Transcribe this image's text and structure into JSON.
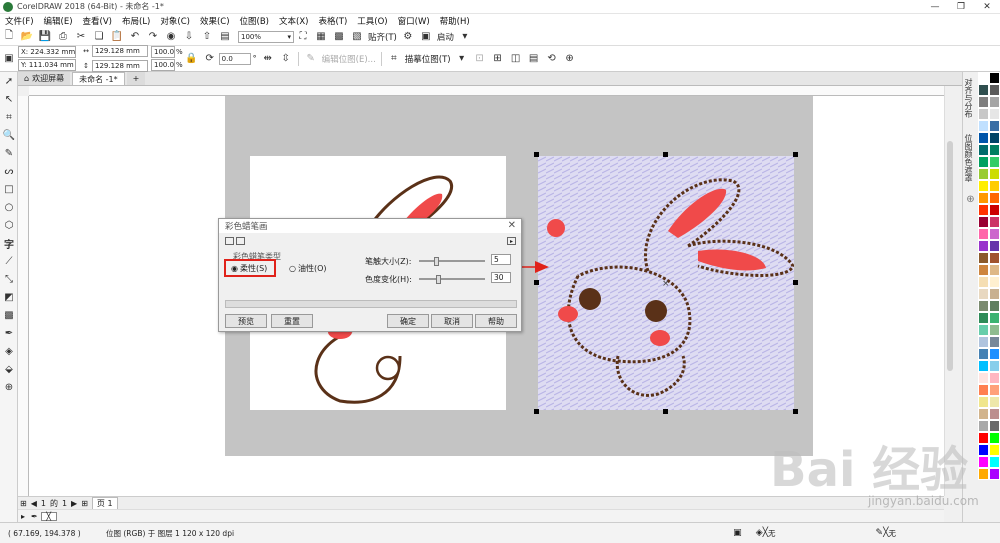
{
  "window": {
    "title": "CorelDRAW 2018 (64-Bit) - 未命名 -1*"
  },
  "menu": [
    "文件(F)",
    "编辑(E)",
    "查看(V)",
    "布局(L)",
    "对象(C)",
    "效果(C)",
    "位图(B)",
    "文本(X)",
    "表格(T)",
    "工具(O)",
    "窗口(W)",
    "帮助(H)"
  ],
  "toolbar": {
    "zoom": "100%",
    "snap": "贴齐(T)",
    "launch": "启动"
  },
  "property_bar": {
    "x": "X: 224.332 mm",
    "y": "Y: 111.034 mm",
    "w": "129.128 mm",
    "h": "129.128 mm",
    "sx": "100.0",
    "sy": "100.0",
    "pct": "%",
    "angle": "0.0",
    "deg": "°",
    "edit_bitmap": "编辑位图(E)...",
    "trace_bitmap": "描摹位图(T)"
  },
  "tabs": {
    "welcome": "欢迎屏幕",
    "doc": "未命名 -1*",
    "add": "+"
  },
  "docker_tabs": [
    "对齐与分布",
    "位图颜色遮罩"
  ],
  "dialog": {
    "title": "彩色蜡笔画",
    "group_label": "彩色蜡笔类型",
    "soft": "柔性(S)",
    "oily": "油性(O)",
    "size_label": "笔触大小(Z):",
    "size_value": "5",
    "color_var_label": "色度变化(H):",
    "color_var_value": "30",
    "preview": "预览",
    "reset": "重置",
    "ok": "确定",
    "cancel": "取消",
    "help": "帮助",
    "size_pct": 0.25,
    "var_pct": 0.28
  },
  "pagenav": {
    "current": "1",
    "of": "的",
    "total": "1",
    "page": "页 1"
  },
  "status": {
    "coords": "( 67.169, 194.378 )",
    "info": "位图 (RGB) 于 图层 1 120 x 120 dpi",
    "fill_none": "无",
    "outline_none": "无"
  },
  "watermark": {
    "brand": "Bai 经验",
    "url": "jingyan.baidu.com"
  },
  "colors": {
    "accent_red": "#e0221a",
    "crayon_bg": "#d9d8f0",
    "ear_red": "#f04a4a",
    "outline_brown": "#5a3118"
  },
  "palette": [
    "#ffffff",
    "#000000",
    "#2f4f4f",
    "#5a5a5a",
    "#7f7f7f",
    "#a5a5a5",
    "#c8c8c8",
    "#e6e6e6",
    "#c0e0ff",
    "#3a6ea5",
    "#0055aa",
    "#004466",
    "#006b6b",
    "#007f5f",
    "#00a060",
    "#33cc66",
    "#99cc33",
    "#ccdd00",
    "#ffee00",
    "#ffcc00",
    "#ff9900",
    "#ff6600",
    "#ff3300",
    "#cc0000",
    "#990033",
    "#cc3366",
    "#ff66aa",
    "#cc66cc",
    "#9933cc",
    "#6633aa",
    "#8b5a2b",
    "#a0522d",
    "#cd853f",
    "#deb887",
    "#f5deb3",
    "#fff0d0",
    "#e8d8c0",
    "#c8b090",
    "#7b8b6f",
    "#5f7f5f",
    "#2e8b57",
    "#3cb371",
    "#66cdaa",
    "#8fbc8f",
    "#b0c4de",
    "#778899",
    "#4682b4",
    "#1e90ff",
    "#00bfff",
    "#87ceeb",
    "#ffe4e1",
    "#ffb6c1",
    "#ff7f50",
    "#ffa07a",
    "#f0e68c",
    "#eee8aa",
    "#d2b48c",
    "#bc8f8f",
    "#a9a9a9",
    "#696969",
    "#ff0000",
    "#00ff00",
    "#0000ff",
    "#ffff00",
    "#ff00ff",
    "#00ffff",
    "#ffaa00",
    "#aa00ff"
  ]
}
